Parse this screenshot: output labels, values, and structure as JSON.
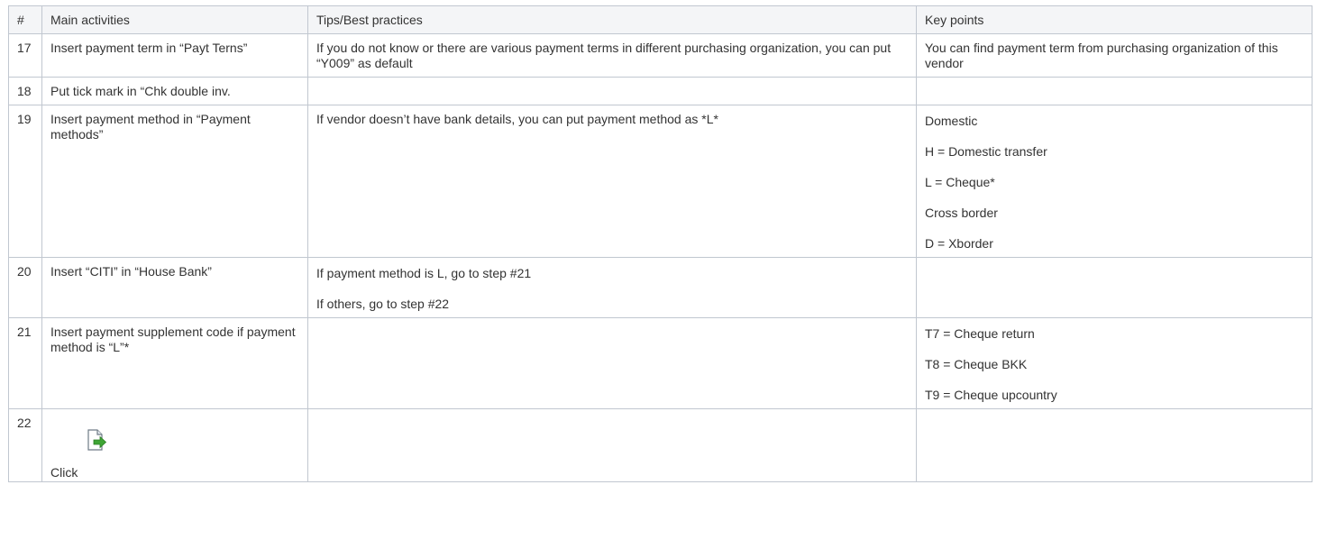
{
  "table": {
    "headers": [
      "#",
      "Main activities",
      "Tips/Best practices",
      "Key points"
    ],
    "rows": [
      {
        "num": "17",
        "activity": "Insert payment term in “Payt Terns”",
        "tips": [
          "If you do not know or there are various payment terms in different purchasing organization, you can put “Y009” as default"
        ],
        "key_points": [
          "You can find payment term from purchasing organization of this vendor"
        ]
      },
      {
        "num": "18",
        "activity": "Put tick mark in “Chk double inv.",
        "tips": [],
        "key_points": []
      },
      {
        "num": "19",
        "activity": "Insert payment method in “Payment methods”",
        "tips": [
          "If vendor doesn’t have bank details, you can put payment method as *L*"
        ],
        "key_points": [
          "Domestic",
          "H = Domestic transfer",
          "L = Cheque*",
          "Cross border",
          "D = Xborder"
        ]
      },
      {
        "num": "20",
        "activity": "Insert “CITI” in “House Bank”",
        "tips": [
          "If payment method is L, go to step #21",
          "If others, go to step #22"
        ],
        "key_points": []
      },
      {
        "num": "21",
        "activity": "Insert payment supplement code if payment method is “L”*",
        "tips": [],
        "key_points": [
          "T7 = Cheque return",
          "T8 = Cheque BKK",
          "T9 = Cheque upcountry"
        ]
      },
      {
        "num": "22",
        "activity": "Click",
        "activity_icon": "document-forward-icon",
        "tips": [],
        "key_points": []
      }
    ]
  }
}
